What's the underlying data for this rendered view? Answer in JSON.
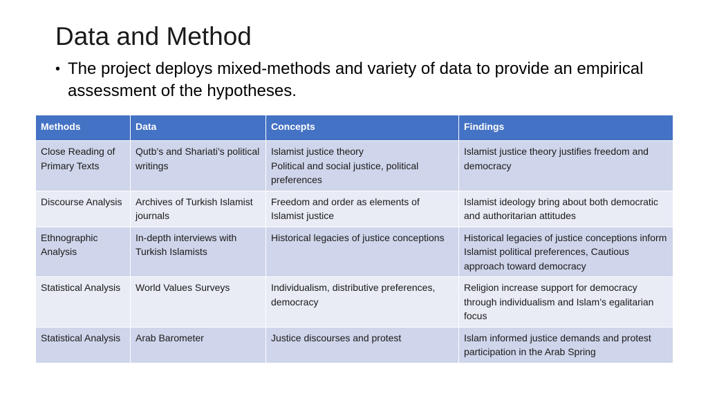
{
  "slide": {
    "title": "Data and Method",
    "bullet": "The project deploys mixed-methods and variety of data to provide an empirical assessment of the hypotheses.",
    "bullet_icon": "bullet-dot"
  },
  "colors": {
    "header_bg": "#4472c4",
    "row_dark": "#cfd5ea",
    "row_light": "#e9ebf5"
  },
  "table": {
    "headers": [
      "Methods",
      "Data",
      "Concepts",
      "Findings"
    ],
    "rows": [
      {
        "methods": "Close Reading of Primary Texts",
        "data": "Qutb’s and Shariati’s political writings",
        "concepts": [
          "Islamist justice theory",
          "Political and social justice, political preferences"
        ],
        "findings": "Islamist justice theory justifies freedom and democracy"
      },
      {
        "methods": "Discourse Analysis",
        "data": "Archives of Turkish Islamist journals",
        "concepts": [
          "Freedom and order as elements of Islamist justice"
        ],
        "findings": "Islamist ideology bring about both democratic and authoritarian attitudes"
      },
      {
        "methods": "Ethnographic Analysis",
        "data": "In-depth interviews with Turkish Islamists",
        "concepts": [
          "Historical legacies of justice conceptions"
        ],
        "findings": "Historical legacies of justice conceptions inform Islamist political preferences, Cautious approach toward democracy"
      },
      {
        "methods": "Statistical Analysis",
        "data": "World Values Surveys",
        "concepts": [
          "Individualism, distributive preferences, democracy"
        ],
        "findings": "Religion increase support for democracy through individualism and Islam’s egalitarian focus"
      },
      {
        "methods": "Statistical Analysis",
        "data": "Arab Barometer",
        "concepts": [
          "Justice discourses and protest"
        ],
        "findings": "Islam informed justice demands and protest participation in the Arab Spring"
      }
    ]
  }
}
